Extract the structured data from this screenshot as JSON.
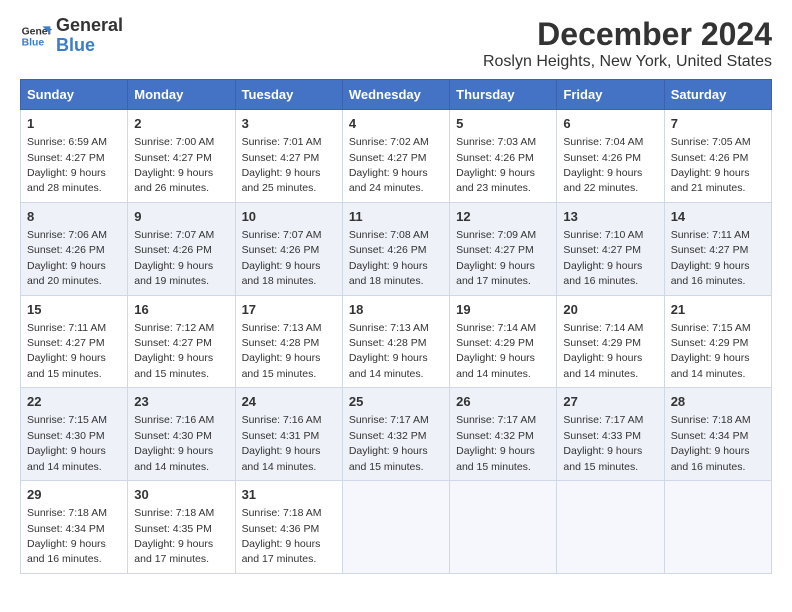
{
  "logo": {
    "line1": "General",
    "line2": "Blue"
  },
  "title": "December 2024",
  "subtitle": "Roslyn Heights, New York, United States",
  "days_of_week": [
    "Sunday",
    "Monday",
    "Tuesday",
    "Wednesday",
    "Thursday",
    "Friday",
    "Saturday"
  ],
  "weeks": [
    [
      {
        "day": 1,
        "sunrise": "6:59 AM",
        "sunset": "4:27 PM",
        "daylight": "9 hours and 28 minutes."
      },
      {
        "day": 2,
        "sunrise": "7:00 AM",
        "sunset": "4:27 PM",
        "daylight": "9 hours and 26 minutes."
      },
      {
        "day": 3,
        "sunrise": "7:01 AM",
        "sunset": "4:27 PM",
        "daylight": "9 hours and 25 minutes."
      },
      {
        "day": 4,
        "sunrise": "7:02 AM",
        "sunset": "4:27 PM",
        "daylight": "9 hours and 24 minutes."
      },
      {
        "day": 5,
        "sunrise": "7:03 AM",
        "sunset": "4:26 PM",
        "daylight": "9 hours and 23 minutes."
      },
      {
        "day": 6,
        "sunrise": "7:04 AM",
        "sunset": "4:26 PM",
        "daylight": "9 hours and 22 minutes."
      },
      {
        "day": 7,
        "sunrise": "7:05 AM",
        "sunset": "4:26 PM",
        "daylight": "9 hours and 21 minutes."
      }
    ],
    [
      {
        "day": 8,
        "sunrise": "7:06 AM",
        "sunset": "4:26 PM",
        "daylight": "9 hours and 20 minutes."
      },
      {
        "day": 9,
        "sunrise": "7:07 AM",
        "sunset": "4:26 PM",
        "daylight": "9 hours and 19 minutes."
      },
      {
        "day": 10,
        "sunrise": "7:07 AM",
        "sunset": "4:26 PM",
        "daylight": "9 hours and 18 minutes."
      },
      {
        "day": 11,
        "sunrise": "7:08 AM",
        "sunset": "4:26 PM",
        "daylight": "9 hours and 18 minutes."
      },
      {
        "day": 12,
        "sunrise": "7:09 AM",
        "sunset": "4:27 PM",
        "daylight": "9 hours and 17 minutes."
      },
      {
        "day": 13,
        "sunrise": "7:10 AM",
        "sunset": "4:27 PM",
        "daylight": "9 hours and 16 minutes."
      },
      {
        "day": 14,
        "sunrise": "7:11 AM",
        "sunset": "4:27 PM",
        "daylight": "9 hours and 16 minutes."
      }
    ],
    [
      {
        "day": 15,
        "sunrise": "7:11 AM",
        "sunset": "4:27 PM",
        "daylight": "9 hours and 15 minutes."
      },
      {
        "day": 16,
        "sunrise": "7:12 AM",
        "sunset": "4:27 PM",
        "daylight": "9 hours and 15 minutes."
      },
      {
        "day": 17,
        "sunrise": "7:13 AM",
        "sunset": "4:28 PM",
        "daylight": "9 hours and 15 minutes."
      },
      {
        "day": 18,
        "sunrise": "7:13 AM",
        "sunset": "4:28 PM",
        "daylight": "9 hours and 14 minutes."
      },
      {
        "day": 19,
        "sunrise": "7:14 AM",
        "sunset": "4:29 PM",
        "daylight": "9 hours and 14 minutes."
      },
      {
        "day": 20,
        "sunrise": "7:14 AM",
        "sunset": "4:29 PM",
        "daylight": "9 hours and 14 minutes."
      },
      {
        "day": 21,
        "sunrise": "7:15 AM",
        "sunset": "4:29 PM",
        "daylight": "9 hours and 14 minutes."
      }
    ],
    [
      {
        "day": 22,
        "sunrise": "7:15 AM",
        "sunset": "4:30 PM",
        "daylight": "9 hours and 14 minutes."
      },
      {
        "day": 23,
        "sunrise": "7:16 AM",
        "sunset": "4:30 PM",
        "daylight": "9 hours and 14 minutes."
      },
      {
        "day": 24,
        "sunrise": "7:16 AM",
        "sunset": "4:31 PM",
        "daylight": "9 hours and 14 minutes."
      },
      {
        "day": 25,
        "sunrise": "7:17 AM",
        "sunset": "4:32 PM",
        "daylight": "9 hours and 15 minutes."
      },
      {
        "day": 26,
        "sunrise": "7:17 AM",
        "sunset": "4:32 PM",
        "daylight": "9 hours and 15 minutes."
      },
      {
        "day": 27,
        "sunrise": "7:17 AM",
        "sunset": "4:33 PM",
        "daylight": "9 hours and 15 minutes."
      },
      {
        "day": 28,
        "sunrise": "7:18 AM",
        "sunset": "4:34 PM",
        "daylight": "9 hours and 16 minutes."
      }
    ],
    [
      {
        "day": 29,
        "sunrise": "7:18 AM",
        "sunset": "4:34 PM",
        "daylight": "9 hours and 16 minutes."
      },
      {
        "day": 30,
        "sunrise": "7:18 AM",
        "sunset": "4:35 PM",
        "daylight": "9 hours and 17 minutes."
      },
      {
        "day": 31,
        "sunrise": "7:18 AM",
        "sunset": "4:36 PM",
        "daylight": "9 hours and 17 minutes."
      },
      null,
      null,
      null,
      null
    ]
  ]
}
